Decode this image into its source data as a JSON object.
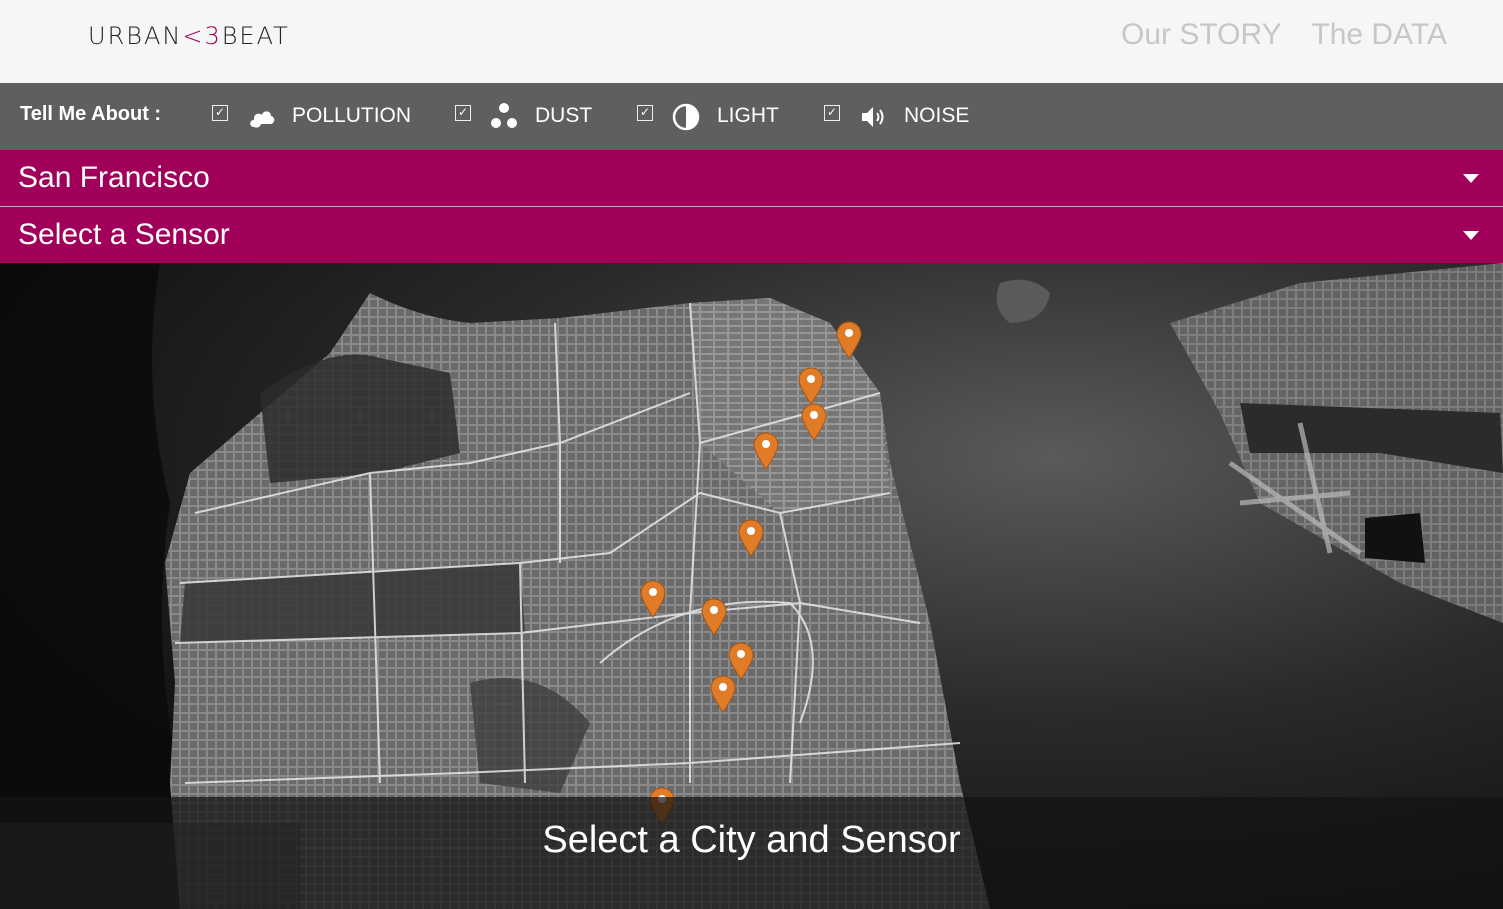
{
  "header": {
    "logo": {
      "left": "URBAN",
      "heart": "<3",
      "right": "BEAT"
    },
    "nav": [
      {
        "label": "Our STORY"
      },
      {
        "label": "The DATA"
      }
    ]
  },
  "filters": {
    "label": "Tell Me About :",
    "items": [
      {
        "label": "POLLUTION",
        "icon": "cloud-icon",
        "checked": true
      },
      {
        "label": "DUST",
        "icon": "dust-icon",
        "checked": true
      },
      {
        "label": "LIGHT",
        "icon": "contrast-icon",
        "checked": true
      },
      {
        "label": "NOISE",
        "icon": "speaker-icon",
        "checked": true
      }
    ]
  },
  "city_select": {
    "value": "San Francisco"
  },
  "sensor_select": {
    "value": "Select a Sensor"
  },
  "map": {
    "overlay_text": "Select a City and Sensor",
    "pin_color": "#e07b27",
    "pin_count": 11
  },
  "colors": {
    "brand": "#a0005a",
    "filter_bar": "#5f5f5f",
    "nav_text": "#c7c7c7"
  }
}
